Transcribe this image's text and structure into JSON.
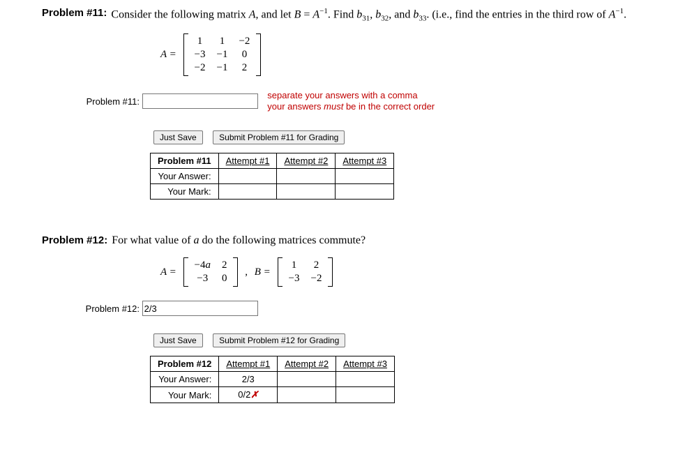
{
  "p11": {
    "label": "Problem #11:",
    "text_part1": "Consider the following matrix ",
    "text_A": "A",
    "text_part2": ", and let ",
    "text_B": "B",
    "text_eq": " = ",
    "text_Ainv": "A",
    "text_part3": ". Find ",
    "b31": "b",
    "s31": "31",
    "b32": "b",
    "s32": "32",
    "b33": "b",
    "s33": "33",
    "text_part4": ". (i.e., find the entries in the third row of ",
    "text_end": ".",
    "comma": ", ",
    "and": ", and ",
    "neg1": "−1",
    "matrixA_label": "A =",
    "matrixA": [
      [
        "1",
        "1",
        "−2"
      ],
      [
        "−3",
        "−1",
        "0"
      ],
      [
        "−2",
        "−1",
        "2"
      ]
    ],
    "answer_label": "Problem #11:",
    "answer_value": "",
    "hint_line1": "separate your answers with a comma",
    "hint_line2a": "your answers ",
    "hint_line2b": "must",
    "hint_line2c": " be in the correct order",
    "btn_save": "Just Save",
    "btn_submit": "Submit Problem #11 for Grading",
    "table": {
      "head": "Problem #11",
      "row2": "Your Answer:",
      "row3": "Your Mark:",
      "a1": "Attempt #1",
      "a2": "Attempt #2",
      "a3": "Attempt #3"
    }
  },
  "p12": {
    "label": "Problem #12:",
    "text_part1": "For what value of ",
    "text_a": "a",
    "text_part2": " do the following matrices commute?",
    "matrixA_label": "A =",
    "matrixA": [
      [
        "−4a",
        "2"
      ],
      [
        "−3",
        "0"
      ]
    ],
    "sepcomma": ",",
    "matrixB_label": "B =",
    "matrixB": [
      [
        "1",
        "2"
      ],
      [
        "−3",
        "−2"
      ]
    ],
    "answer_label": "Problem #12:",
    "answer_value": "2/3",
    "btn_save": "Just Save",
    "btn_submit": "Submit Problem #12 for Grading",
    "table": {
      "head": "Problem #12",
      "row2": "Your Answer:",
      "row3": "Your Mark:",
      "a1": "Attempt #1",
      "a2": "Attempt #2",
      "a3": "Attempt #3",
      "ans1": "2/3",
      "mark1a": "0/2",
      "mark1b": "✗"
    }
  }
}
